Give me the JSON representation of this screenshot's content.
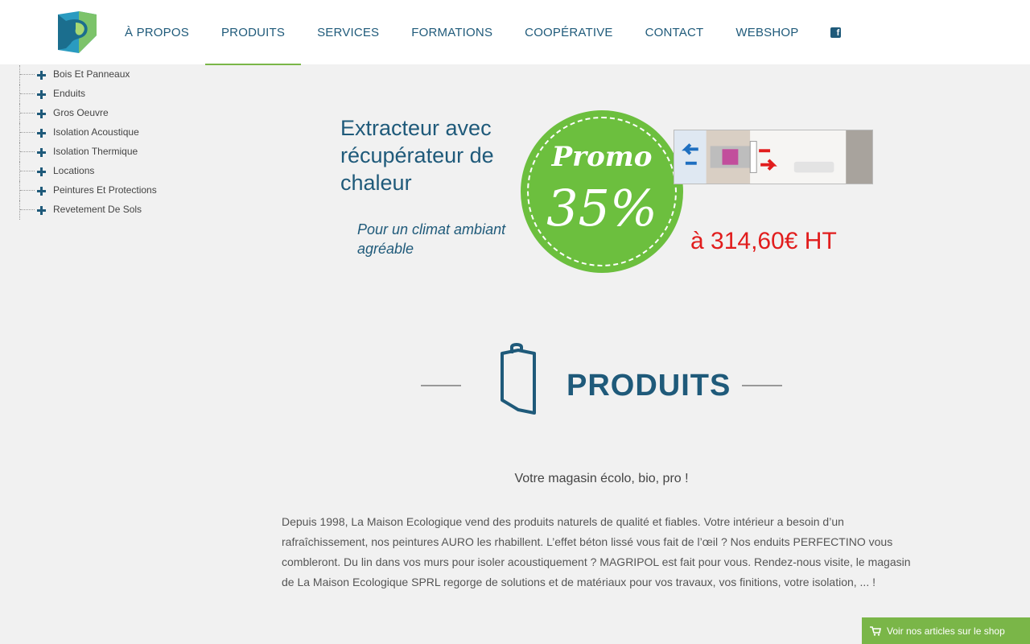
{
  "nav": {
    "items": [
      {
        "label": "À PROPOS"
      },
      {
        "label": "PRODUITS",
        "active": true
      },
      {
        "label": "SERVICES"
      },
      {
        "label": "FORMATIONS"
      },
      {
        "label": "COOPÉRATIVE"
      },
      {
        "label": "CONTACT"
      },
      {
        "label": "WEBSHOP"
      }
    ],
    "social_icon": "facebook-icon"
  },
  "categories": [
    "Bois Et Panneaux",
    "Enduits",
    "Gros Oeuvre",
    "Isolation Acoustique",
    "Isolation Thermique",
    "Locations",
    "Peintures Et Protections",
    "Revetement De Sols"
  ],
  "promo": {
    "title": "Extracteur avec récupérateur de chaleur",
    "subtitle": "Pour un climat ambiant agréable",
    "badge_word": "Promo",
    "badge_percent": "35%",
    "price": "à 314,60€ HT"
  },
  "section": {
    "title": "PRODUITS",
    "icon": "shopping-bag-icon",
    "tagline": "Votre magasin écolo, bio, pro !",
    "body": "Depuis 1998, La Maison Ecologique vend des produits naturels de qualité et fiables. Votre intérieur a besoin d’un rafraîchissement, nos peintures AURO les rhabillent. L’effet béton lissé vous fait de l’œil ? Nos enduits PERFECTINO vous combleront. Du lin dans vos murs pour isoler acoustiquement ? MAGRIPOL est fait pour vous. Rendez-nous visite, le magasin de La Maison Ecologique SPRL regorge de solutions et de matériaux pour vos travaux, vos finitions, votre isolation, ... !"
  },
  "shop_button": {
    "label": "Voir nos articles sur le shop",
    "icon": "cart-icon"
  },
  "colors": {
    "brand_blue": "#1f5a7a",
    "brand_green": "#7ab648",
    "promo_green": "#6cbf3e",
    "price_red": "#e11d1d"
  }
}
